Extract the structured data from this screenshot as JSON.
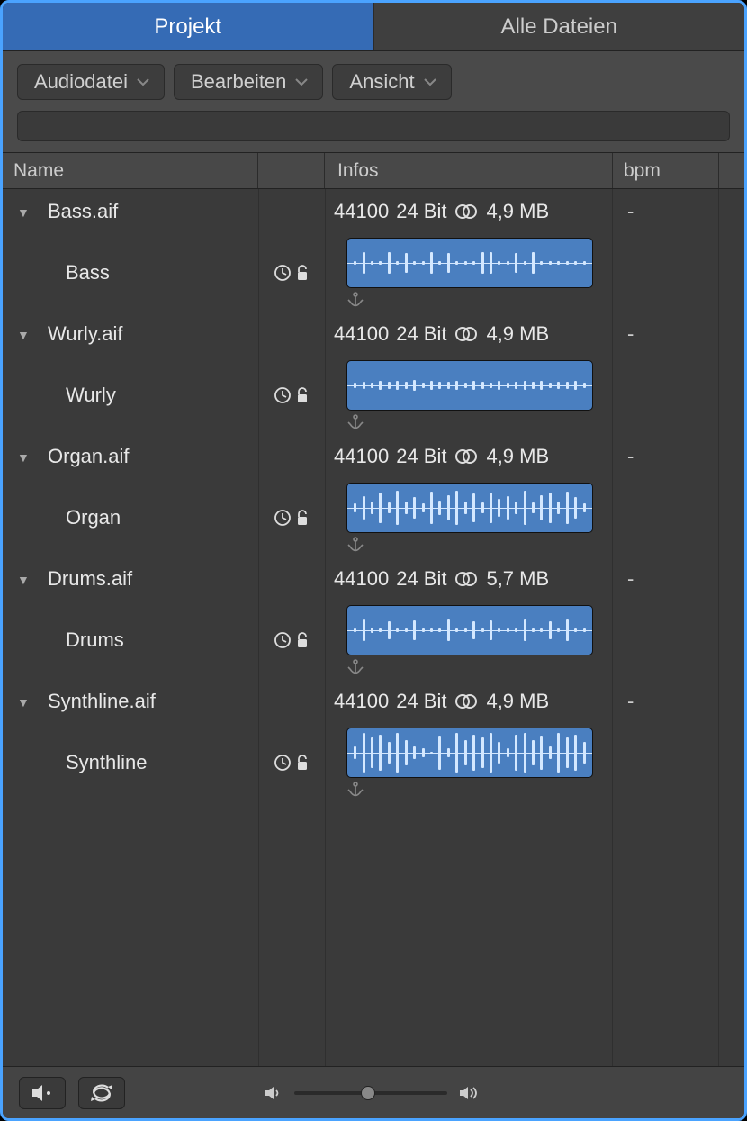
{
  "tabs": {
    "project": "Projekt",
    "allfiles": "Alle Dateien"
  },
  "toolbar": {
    "audiofile": "Audiodatei",
    "edit": "Bearbeiten",
    "view": "Ansicht"
  },
  "columns": {
    "name": "Name",
    "info": "Infos",
    "bpm": "bpm"
  },
  "files": [
    {
      "filename": "Bass.aif",
      "region": "Bass",
      "samplerate": "44100",
      "bitdepth": "24 Bit",
      "size": "4,9 MB",
      "bpm": "-",
      "wavePattern": "bass"
    },
    {
      "filename": "Wurly.aif",
      "region": "Wurly",
      "samplerate": "44100",
      "bitdepth": "24 Bit",
      "size": "4,9 MB",
      "bpm": "-",
      "wavePattern": "wurly"
    },
    {
      "filename": "Organ.aif",
      "region": "Organ",
      "samplerate": "44100",
      "bitdepth": "24 Bit",
      "size": "4,9 MB",
      "bpm": "-",
      "wavePattern": "organ"
    },
    {
      "filename": "Drums.aif",
      "region": "Drums",
      "samplerate": "44100",
      "bitdepth": "24 Bit",
      "size": "5,7 MB",
      "bpm": "-",
      "wavePattern": "drums"
    },
    {
      "filename": "Synthline.aif",
      "region": "Synthline",
      "samplerate": "44100",
      "bitdepth": "24 Bit",
      "size": "4,9 MB",
      "bpm": "-",
      "wavePattern": "synth"
    }
  ]
}
